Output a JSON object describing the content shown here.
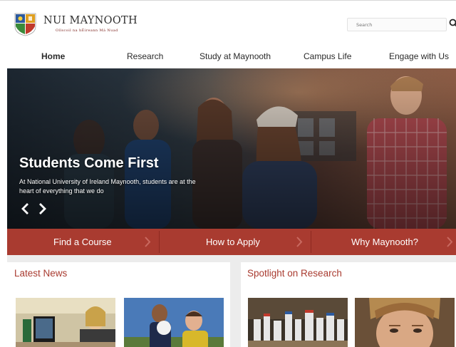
{
  "brand": {
    "title": "NUI MAYNOOTH",
    "tagline": "Ollscoil na hÉireann Má Nuad",
    "colors": {
      "accent": "#a93b30",
      "text": "#2a2a2a"
    }
  },
  "search": {
    "placeholder": "Search",
    "icon": "search-icon"
  },
  "nav": {
    "items": [
      {
        "label": "Home",
        "active": true
      },
      {
        "label": "Research"
      },
      {
        "label": "Study at Maynooth"
      },
      {
        "label": "Campus Life"
      },
      {
        "label": "Engage with Us"
      }
    ]
  },
  "hero": {
    "title": "Students Come First",
    "description": "At National University of Ireland Maynooth, students are at the heart of everything that we do",
    "prev_icon": "chevron-left-icon",
    "next_icon": "chevron-right-icon"
  },
  "quick_links": [
    {
      "label": "Find a Course"
    },
    {
      "label": "How to Apply"
    },
    {
      "label": "Why Maynooth?"
    }
  ],
  "sections": {
    "news": {
      "title": "Latest News"
    },
    "research": {
      "title": "Spotlight on Research"
    }
  }
}
